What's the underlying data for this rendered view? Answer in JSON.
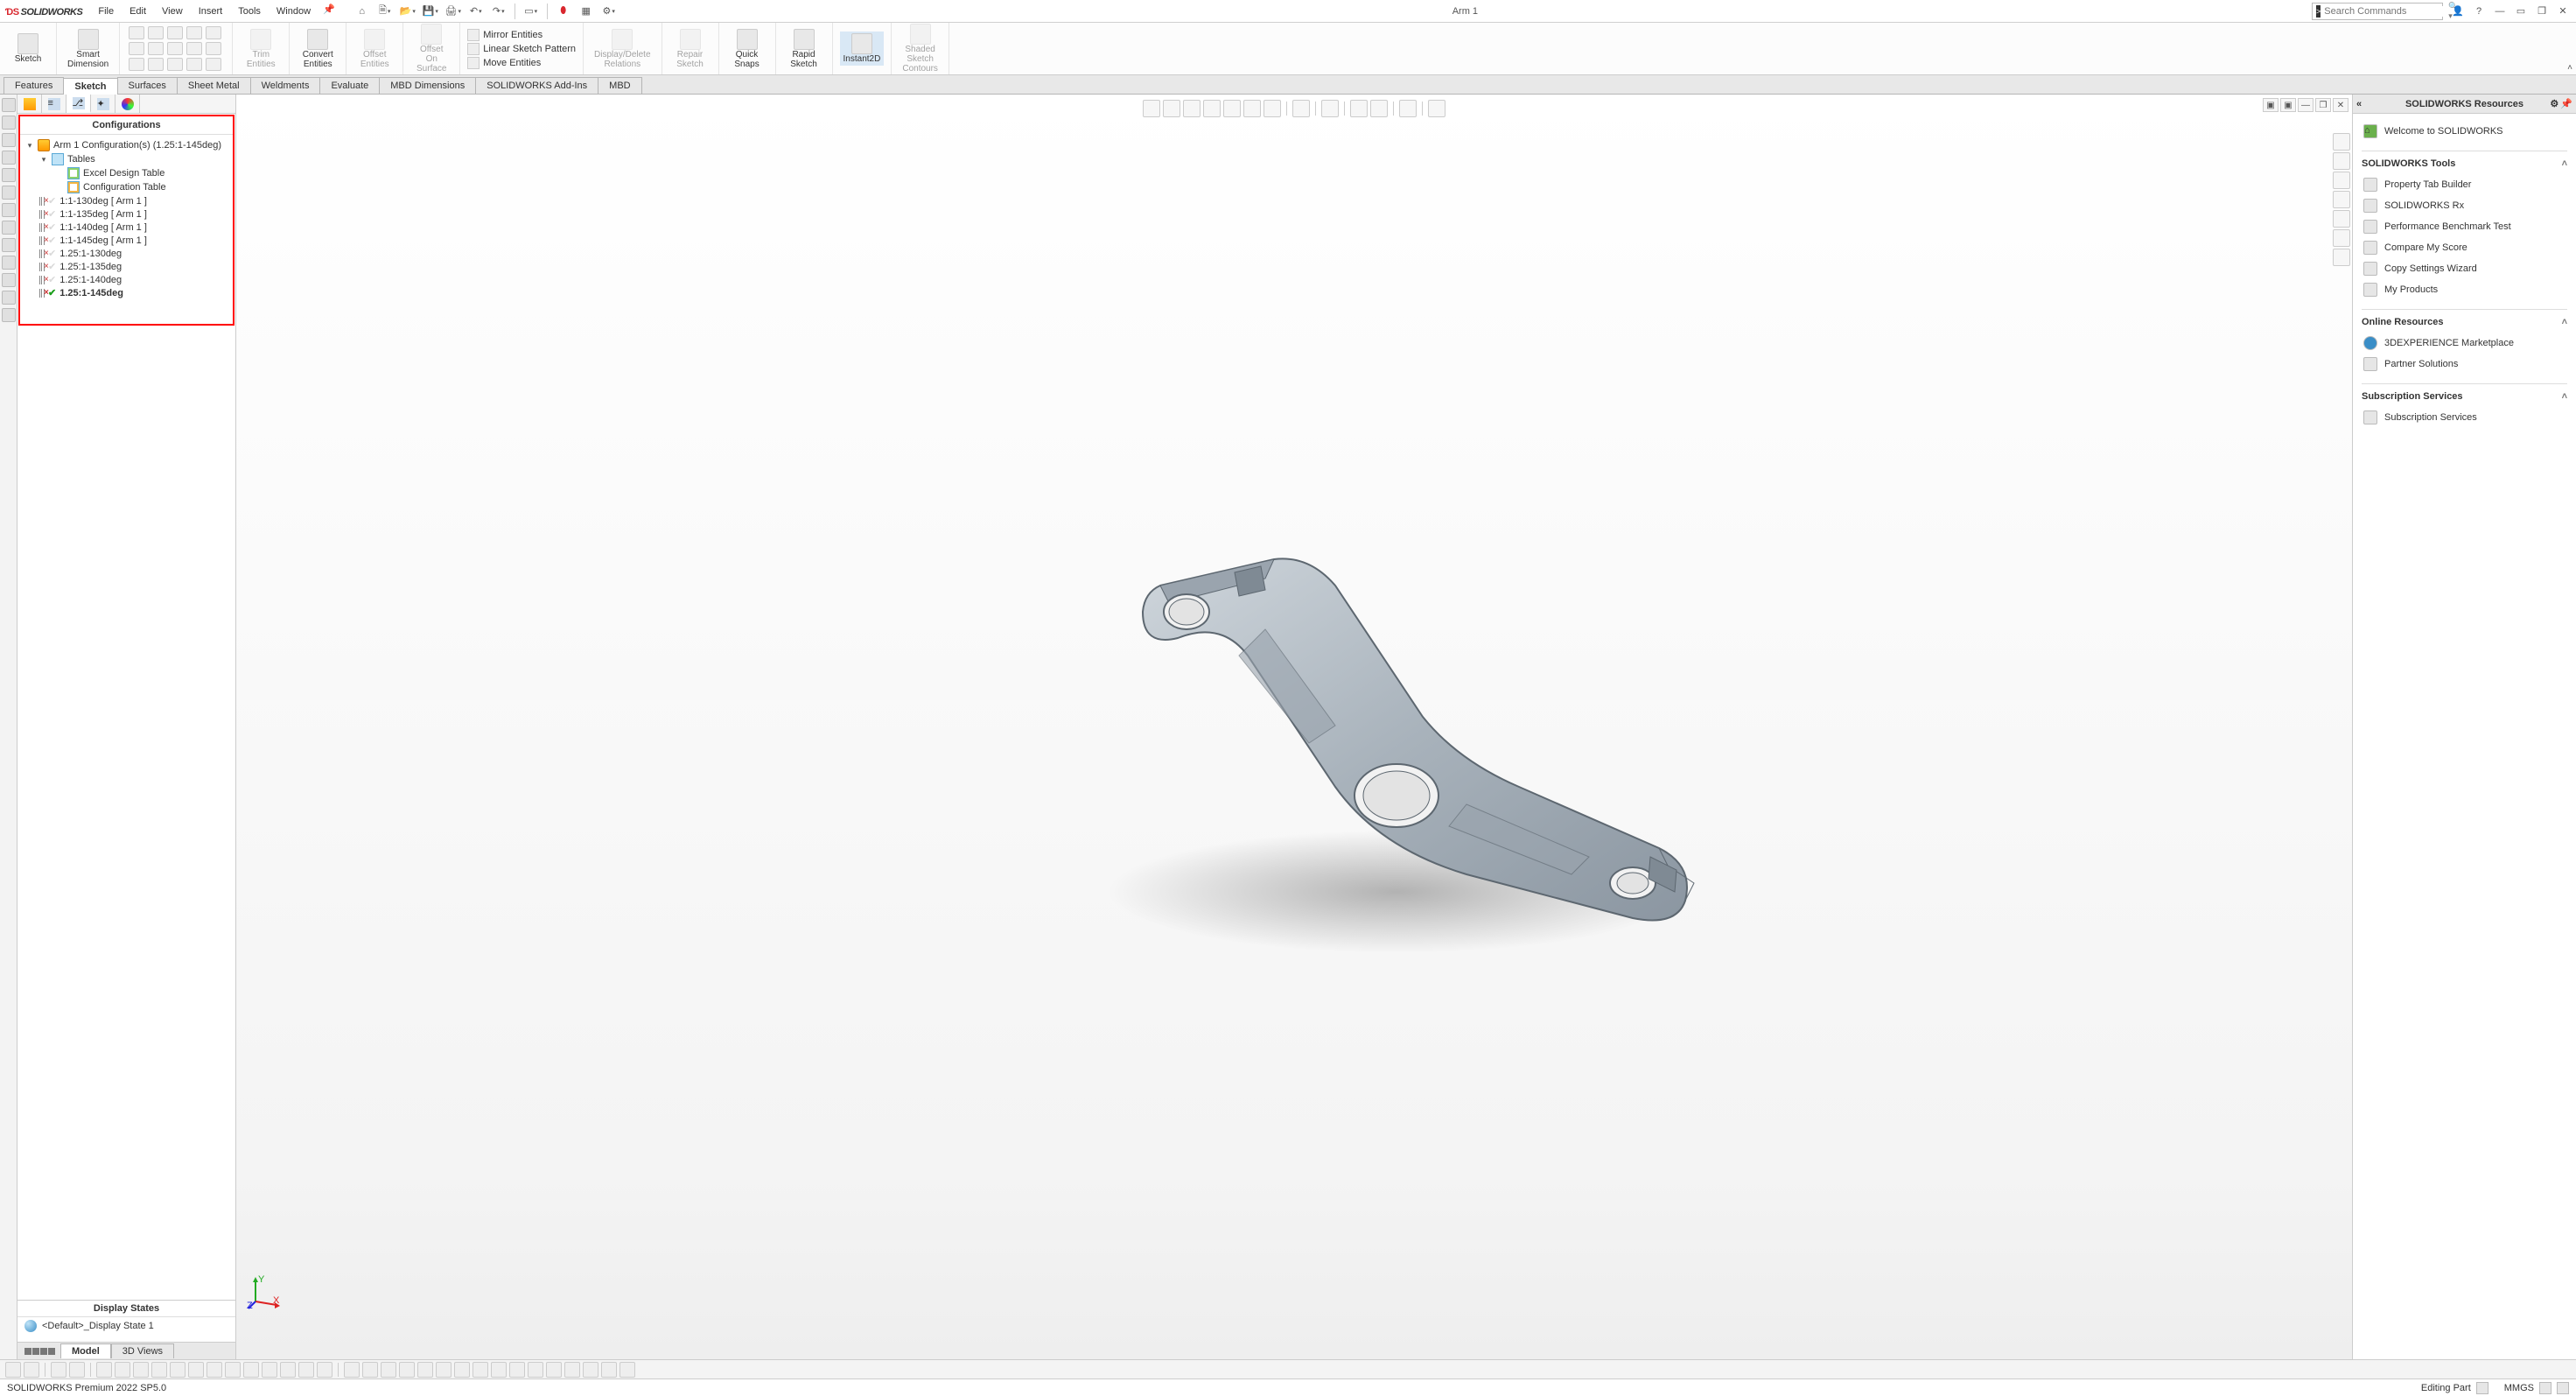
{
  "app": {
    "brand": "SOLIDWORKS",
    "document_title": "Arm 1",
    "menus": [
      "File",
      "Edit",
      "View",
      "Insert",
      "Tools",
      "Window"
    ]
  },
  "search": {
    "placeholder": "Search Commands"
  },
  "ribbon": {
    "sketch": {
      "label": "Sketch"
    },
    "smartdim": {
      "label1": "Smart",
      "label2": "Dimension"
    },
    "trim": {
      "label1": "Trim",
      "label2": "Entities"
    },
    "convert": {
      "label1": "Convert",
      "label2": "Entities"
    },
    "offset": {
      "label1": "Offset",
      "label2": "Entities"
    },
    "offset_surface": {
      "label1": "Offset",
      "label2": "On",
      "label3": "Surface"
    },
    "mirror": {
      "label": "Mirror Entities"
    },
    "pattern": {
      "label": "Linear Sketch Pattern"
    },
    "move": {
      "label": "Move Entities"
    },
    "disp_del": {
      "label1": "Display/Delete",
      "label2": "Relations"
    },
    "repair": {
      "label1": "Repair",
      "label2": "Sketch"
    },
    "quick": {
      "label1": "Quick",
      "label2": "Snaps"
    },
    "rapid": {
      "label1": "Rapid",
      "label2": "Sketch"
    },
    "instant": {
      "label": "Instant2D"
    },
    "shaded": {
      "label1": "Shaded",
      "label2": "Sketch",
      "label3": "Contours"
    }
  },
  "cmdtabs": [
    "Features",
    "Sketch",
    "Surfaces",
    "Sheet Metal",
    "Weldments",
    "Evaluate",
    "MBD Dimensions",
    "SOLIDWORKS Add-Ins",
    "MBD"
  ],
  "cmdtabs_active": 1,
  "config_panel": {
    "header": "Configurations",
    "root": "Arm 1 Configuration(s)  (1.25:1-145deg)",
    "tables_label": "Tables",
    "tables": [
      "Excel Design Table",
      "Configuration Table"
    ],
    "configs": [
      {
        "name": "1:1-130deg [ Arm 1 ]",
        "active": false
      },
      {
        "name": "1:1-135deg [ Arm 1 ]",
        "active": false
      },
      {
        "name": "1:1-140deg [ Arm 1 ]",
        "active": false
      },
      {
        "name": "1:1-145deg [ Arm 1 ]",
        "active": false
      },
      {
        "name": "1.25:1-130deg",
        "active": false
      },
      {
        "name": "1.25:1-135deg",
        "active": false
      },
      {
        "name": "1.25:1-140deg",
        "active": false
      },
      {
        "name": "1.25:1-145deg",
        "active": true
      }
    ],
    "display_states_header": "Display States",
    "display_state": "<Default>_Display State 1"
  },
  "bottom_tabs": {
    "model": "Model",
    "views3d": "3D Views"
  },
  "taskpane": {
    "title": "SOLIDWORKS Resources",
    "welcome": "Welcome to SOLIDWORKS",
    "tools_header": "SOLIDWORKS Tools",
    "tools": [
      "Property Tab Builder",
      "SOLIDWORKS Rx",
      "Performance Benchmark Test",
      "Compare My Score",
      "Copy Settings Wizard",
      "My Products"
    ],
    "online_header": "Online Resources",
    "online": [
      "3DEXPERIENCE Marketplace",
      "Partner Solutions"
    ],
    "subs_header": "Subscription Services",
    "subs": [
      "Subscription Services"
    ]
  },
  "status": {
    "product": "SOLIDWORKS Premium 2022 SP5.0",
    "mode": "Editing Part",
    "units": "MMGS"
  }
}
